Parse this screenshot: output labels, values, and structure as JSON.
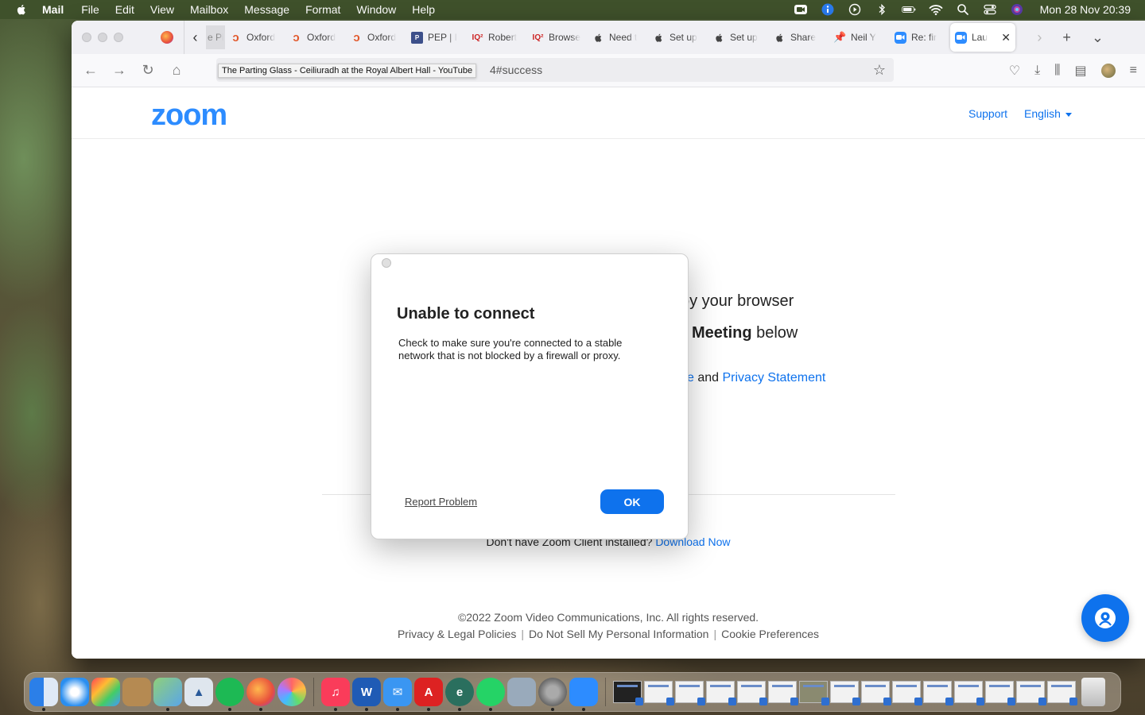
{
  "menubar": {
    "app_name": "Mail",
    "items": [
      "File",
      "Edit",
      "View",
      "Mailbox",
      "Message",
      "Format",
      "Window",
      "Help"
    ],
    "clock": "Mon 28 Nov  20:39"
  },
  "tabs": [
    {
      "label": "e Pi",
      "icon": "page-icon",
      "partial": true
    },
    {
      "label": "Oxford",
      "icon": "oxford-icon"
    },
    {
      "label": "Oxford",
      "icon": "oxford-icon"
    },
    {
      "label": "Oxford",
      "icon": "oxford-icon"
    },
    {
      "label": "PEP | I",
      "icon": "pep-icon"
    },
    {
      "label": "Robert",
      "icon": "iq-icon"
    },
    {
      "label": "Browse",
      "icon": "iq-icon"
    },
    {
      "label": "Need t",
      "icon": "apple-icon"
    },
    {
      "label": "Set up",
      "icon": "apple-icon"
    },
    {
      "label": "Set up",
      "icon": "apple-icon"
    },
    {
      "label": "Share",
      "icon": "apple-icon"
    },
    {
      "label": "Neil Y",
      "icon": "pin-icon"
    },
    {
      "label": "Re: fir",
      "icon": "zoom-icon"
    },
    {
      "label": "Lau",
      "icon": "zoom-icon",
      "active": true
    }
  ],
  "address_bar": {
    "url_tail": "4#success",
    "tooltip": "The Parting Glass - Ceiliuradh at the Royal Albert Hall - YouTube"
  },
  "zoom_page": {
    "logo": "zoom",
    "support_link": "Support",
    "language": "English",
    "bg_line1": "by your browser",
    "bg_line2_bold": "Meeting",
    "bg_line2_rest": " below",
    "bg_line3_link1": "ce",
    "bg_line3_and": " and ",
    "bg_line3_link2": "Privacy Statement",
    "download_prompt": "Don't have Zoom Client installed? ",
    "download_link": "Download Now",
    "copyright": "©2022 Zoom Video Communications, Inc. All rights reserved.",
    "footer_links": [
      "Privacy & Legal Policies",
      "Do Not Sell My Personal Information",
      "Cookie Preferences"
    ]
  },
  "dialog": {
    "title": "Unable to connect",
    "body": "Check to make sure you're connected to a stable network that is not blocked by a firewall or proxy.",
    "report_label": "Report Problem",
    "ok_label": "OK"
  },
  "colors": {
    "zoom_blue": "#2d8cff",
    "link_blue": "#0e72ed"
  }
}
